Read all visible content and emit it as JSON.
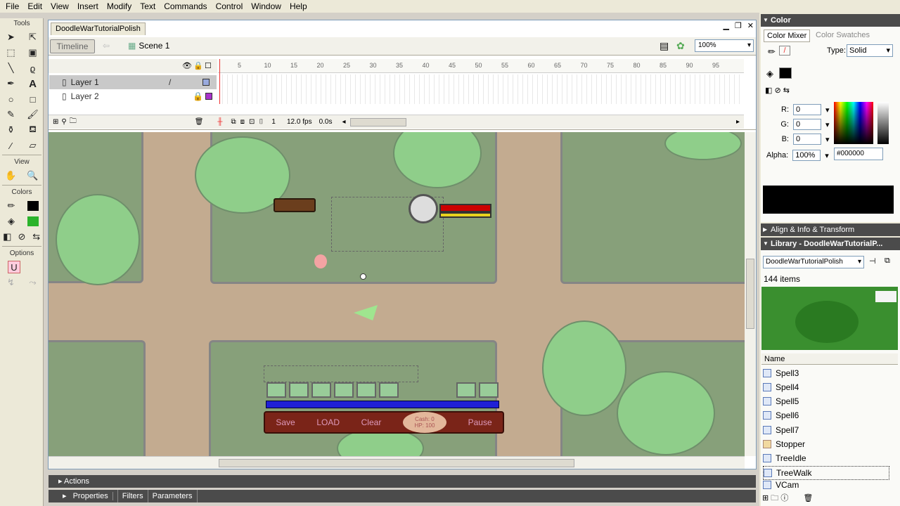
{
  "menu": [
    "File",
    "Edit",
    "View",
    "Insert",
    "Modify",
    "Text",
    "Commands",
    "Control",
    "Window",
    "Help"
  ],
  "tools": {
    "title": "Tools",
    "view_title": "View",
    "colors_title": "Colors",
    "options_title": "Options"
  },
  "document": {
    "tab_title": "DoodleWarTutorialPolish",
    "timeline_button": "Timeline",
    "scene": "Scene 1",
    "zoom": "100%"
  },
  "timeline": {
    "layers": [
      {
        "name": "Layer 1"
      },
      {
        "name": "Layer 2"
      }
    ],
    "ruler_ticks": [
      "5",
      "10",
      "15",
      "20",
      "25",
      "30",
      "35",
      "40",
      "45",
      "50",
      "55",
      "60",
      "65",
      "70",
      "75",
      "80",
      "85",
      "90",
      "95"
    ],
    "frame": "1",
    "fps": "12.0 fps",
    "time": "0.0s"
  },
  "bottom_panels": {
    "actions": "Actions",
    "tabs": [
      "Properties",
      "Filters",
      "Parameters"
    ]
  },
  "color_panel": {
    "title": "Color",
    "tab_mixer": "Color Mixer",
    "tab_swatches": "Color Swatches",
    "type_label": "Type:",
    "type_value": "Solid",
    "r_label": "R:",
    "r_value": "0",
    "g_label": "G:",
    "g_value": "0",
    "b_label": "B:",
    "b_value": "0",
    "alpha_label": "Alpha:",
    "alpha_value": "100%",
    "hex": "#000000"
  },
  "align_panel": {
    "title": "Align & Info & Transform"
  },
  "library": {
    "title": "Library - DoodleWarTutorialP...",
    "select_value": "DoodleWarTutorialPolish",
    "count": "144 items",
    "name_header": "Name",
    "items": [
      "Spell3",
      "Spell4",
      "Spell5",
      "Spell6",
      "Spell7",
      "Stopper",
      "TreeIdle",
      "TreeWalk",
      "VCam"
    ]
  },
  "game_buttons": [
    "Save",
    "LOAD",
    "Clear",
    "Pause"
  ],
  "hud_text": {
    "cash": "Cash: 0",
    "hp": "HP: 100"
  },
  "colors": {
    "stage_path": "#c3ab90",
    "grass": "#87a07a",
    "tree": "#8fce8a",
    "panel_header": "#4b4b4b"
  }
}
